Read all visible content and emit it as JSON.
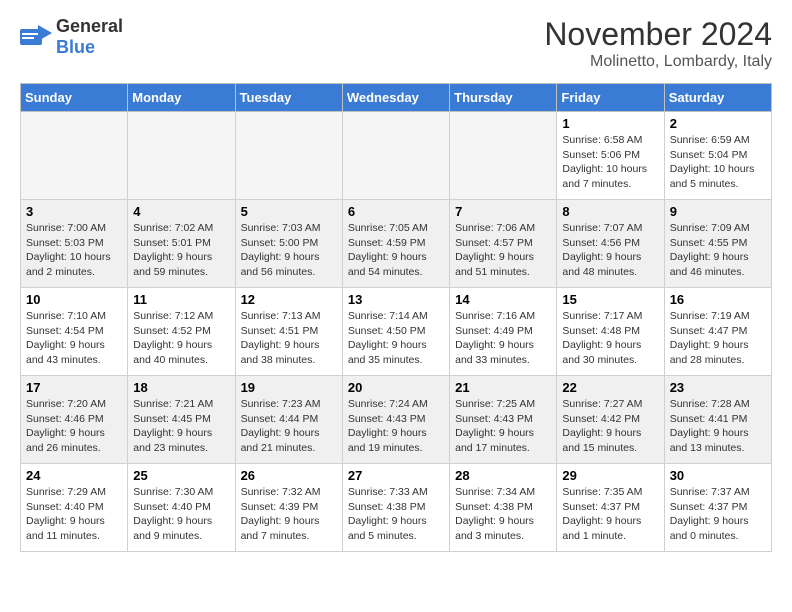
{
  "header": {
    "logo": {
      "general": "General",
      "blue": "Blue"
    },
    "title": "November 2024",
    "location": "Molinetto, Lombardy, Italy"
  },
  "weekdays": [
    "Sunday",
    "Monday",
    "Tuesday",
    "Wednesday",
    "Thursday",
    "Friday",
    "Saturday"
  ],
  "weeks": [
    [
      {
        "day": "",
        "info": ""
      },
      {
        "day": "",
        "info": ""
      },
      {
        "day": "",
        "info": ""
      },
      {
        "day": "",
        "info": ""
      },
      {
        "day": "",
        "info": ""
      },
      {
        "day": "1",
        "info": "Sunrise: 6:58 AM\nSunset: 5:06 PM\nDaylight: 10 hours and 7 minutes."
      },
      {
        "day": "2",
        "info": "Sunrise: 6:59 AM\nSunset: 5:04 PM\nDaylight: 10 hours and 5 minutes."
      }
    ],
    [
      {
        "day": "3",
        "info": "Sunrise: 7:00 AM\nSunset: 5:03 PM\nDaylight: 10 hours and 2 minutes."
      },
      {
        "day": "4",
        "info": "Sunrise: 7:02 AM\nSunset: 5:01 PM\nDaylight: 9 hours and 59 minutes."
      },
      {
        "day": "5",
        "info": "Sunrise: 7:03 AM\nSunset: 5:00 PM\nDaylight: 9 hours and 56 minutes."
      },
      {
        "day": "6",
        "info": "Sunrise: 7:05 AM\nSunset: 4:59 PM\nDaylight: 9 hours and 54 minutes."
      },
      {
        "day": "7",
        "info": "Sunrise: 7:06 AM\nSunset: 4:57 PM\nDaylight: 9 hours and 51 minutes."
      },
      {
        "day": "8",
        "info": "Sunrise: 7:07 AM\nSunset: 4:56 PM\nDaylight: 9 hours and 48 minutes."
      },
      {
        "day": "9",
        "info": "Sunrise: 7:09 AM\nSunset: 4:55 PM\nDaylight: 9 hours and 46 minutes."
      }
    ],
    [
      {
        "day": "10",
        "info": "Sunrise: 7:10 AM\nSunset: 4:54 PM\nDaylight: 9 hours and 43 minutes."
      },
      {
        "day": "11",
        "info": "Sunrise: 7:12 AM\nSunset: 4:52 PM\nDaylight: 9 hours and 40 minutes."
      },
      {
        "day": "12",
        "info": "Sunrise: 7:13 AM\nSunset: 4:51 PM\nDaylight: 9 hours and 38 minutes."
      },
      {
        "day": "13",
        "info": "Sunrise: 7:14 AM\nSunset: 4:50 PM\nDaylight: 9 hours and 35 minutes."
      },
      {
        "day": "14",
        "info": "Sunrise: 7:16 AM\nSunset: 4:49 PM\nDaylight: 9 hours and 33 minutes."
      },
      {
        "day": "15",
        "info": "Sunrise: 7:17 AM\nSunset: 4:48 PM\nDaylight: 9 hours and 30 minutes."
      },
      {
        "day": "16",
        "info": "Sunrise: 7:19 AM\nSunset: 4:47 PM\nDaylight: 9 hours and 28 minutes."
      }
    ],
    [
      {
        "day": "17",
        "info": "Sunrise: 7:20 AM\nSunset: 4:46 PM\nDaylight: 9 hours and 26 minutes."
      },
      {
        "day": "18",
        "info": "Sunrise: 7:21 AM\nSunset: 4:45 PM\nDaylight: 9 hours and 23 minutes."
      },
      {
        "day": "19",
        "info": "Sunrise: 7:23 AM\nSunset: 4:44 PM\nDaylight: 9 hours and 21 minutes."
      },
      {
        "day": "20",
        "info": "Sunrise: 7:24 AM\nSunset: 4:43 PM\nDaylight: 9 hours and 19 minutes."
      },
      {
        "day": "21",
        "info": "Sunrise: 7:25 AM\nSunset: 4:43 PM\nDaylight: 9 hours and 17 minutes."
      },
      {
        "day": "22",
        "info": "Sunrise: 7:27 AM\nSunset: 4:42 PM\nDaylight: 9 hours and 15 minutes."
      },
      {
        "day": "23",
        "info": "Sunrise: 7:28 AM\nSunset: 4:41 PM\nDaylight: 9 hours and 13 minutes."
      }
    ],
    [
      {
        "day": "24",
        "info": "Sunrise: 7:29 AM\nSunset: 4:40 PM\nDaylight: 9 hours and 11 minutes."
      },
      {
        "day": "25",
        "info": "Sunrise: 7:30 AM\nSunset: 4:40 PM\nDaylight: 9 hours and 9 minutes."
      },
      {
        "day": "26",
        "info": "Sunrise: 7:32 AM\nSunset: 4:39 PM\nDaylight: 9 hours and 7 minutes."
      },
      {
        "day": "27",
        "info": "Sunrise: 7:33 AM\nSunset: 4:38 PM\nDaylight: 9 hours and 5 minutes."
      },
      {
        "day": "28",
        "info": "Sunrise: 7:34 AM\nSunset: 4:38 PM\nDaylight: 9 hours and 3 minutes."
      },
      {
        "day": "29",
        "info": "Sunrise: 7:35 AM\nSunset: 4:37 PM\nDaylight: 9 hours and 1 minute."
      },
      {
        "day": "30",
        "info": "Sunrise: 7:37 AM\nSunset: 4:37 PM\nDaylight: 9 hours and 0 minutes."
      }
    ]
  ]
}
